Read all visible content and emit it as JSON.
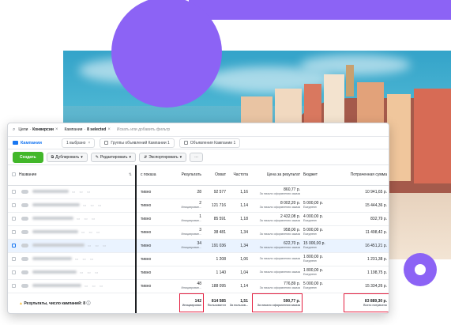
{
  "filter_bar": {
    "chips": [
      {
        "prefix": "Цели",
        "value": "Конверсии"
      },
      {
        "prefix": "Кампании",
        "value": "8 selected"
      }
    ],
    "placeholder": "Искать или добавить фильтр"
  },
  "tabs": {
    "main": "Кампании",
    "selected": "1 выбрано",
    "adsets": "Группы объявлений Кампании 1",
    "ads": "Объявления Кампании 1"
  },
  "toolbar": {
    "create": "Создать",
    "duplicate": "Дублировать",
    "edit": "Редактировать",
    "export": "Экспортировать",
    "more": "···"
  },
  "table": {
    "headers": {
      "name": "Название",
      "delivery": "с показа",
      "results": "Результать",
      "reach": "Охват",
      "frequency": "Частота",
      "cost_per_result": "Цена за результат",
      "budget": "Бюджет",
      "spent": "Потраченная сумма"
    },
    "rows": [
      {
        "delivery": "тивно",
        "results": "28",
        "results_sub": "",
        "reach": "92 577",
        "frequency": "1,16",
        "cost": "860,77 р.",
        "cost_sub": "За начало оформления заказа",
        "budget": "",
        "budget_sub": "",
        "spent": "10 941,65 р."
      },
      {
        "delivery": "тивно",
        "results": "2",
        "results_sub": "Инициирован...",
        "reach": "121 716",
        "frequency": "1,14",
        "cost": "8 002,20 р.",
        "cost_sub": "За начало оформления заказа",
        "budget": "5 000,00 р.",
        "budget_sub": "Ежедневн",
        "spent": "15 444,36 р."
      },
      {
        "delivery": "тивно",
        "results": "1",
        "results_sub": "Инициирован...",
        "reach": "85 591",
        "frequency": "1,18",
        "cost": "2 432,08 р.",
        "cost_sub": "За начало оформления заказа",
        "budget": "4 000,00 р.",
        "budget_sub": "Ежедневн",
        "spent": "832,79 р."
      },
      {
        "delivery": "тивно",
        "results": "3",
        "results_sub": "Инициирован...",
        "reach": "38 481",
        "frequency": "1,34",
        "cost": "958,00 р.",
        "cost_sub": "За начало оформления заказа",
        "budget": "5 000,00 р.",
        "budget_sub": "Ежедневн",
        "spent": "11 498,42 р."
      },
      {
        "delivery": "тивно",
        "results": "34",
        "results_sub": "Инициирован...",
        "reach": "191 036",
        "frequency": "1,34",
        "cost": "622,70 р.",
        "cost_sub": "За начало оформления заказа",
        "budget": "15 000,00 р.",
        "budget_sub": "Ежедневн",
        "spent": "16 451,21 р.",
        "selected": true
      },
      {
        "delivery": "тивно",
        "results": "",
        "results_sub": "",
        "reach": "1 208",
        "frequency": "1,06",
        "cost": "",
        "cost_sub": "За начало оформления заказа",
        "budget": "1 800,00 р.",
        "budget_sub": "Ежедневн",
        "spent": "1 231,38 р."
      },
      {
        "delivery": "тивно",
        "results": "",
        "results_sub": "",
        "reach": "1 140",
        "frequency": "1,04",
        "cost": "",
        "cost_sub": "За начало оформления заказа",
        "budget": "1 800,00 р.",
        "budget_sub": "Ежедневн",
        "spent": "1 198,75 р."
      },
      {
        "delivery": "тивно",
        "results": "48",
        "results_sub": "Инициирован...",
        "reach": "188 095",
        "frequency": "1,14",
        "cost": "776,89 р.",
        "cost_sub": "За начало оформления заказа",
        "budget": "5 000,00 р.",
        "budget_sub": "Ежедневн",
        "spent": "15 334,26 р."
      }
    ],
    "summary": {
      "label": "Результаты, число кампаний: 8",
      "results": "142",
      "results_sub": "Инициирован",
      "reach": "814 585",
      "reach_sub": "Пользовател",
      "frequency": "1,51",
      "frequency_sub": "За пользов...",
      "cost": "590,77 р.",
      "cost_sub": "За начало оформления заказа",
      "spent": "83 889,30 р.",
      "spent_sub": "Всего потрачено"
    }
  },
  "colors": {
    "accent": "#8c63f5",
    "primary_button": "#42b72a",
    "link_blue": "#1877f2",
    "highlight_red": "#e41e3f"
  }
}
